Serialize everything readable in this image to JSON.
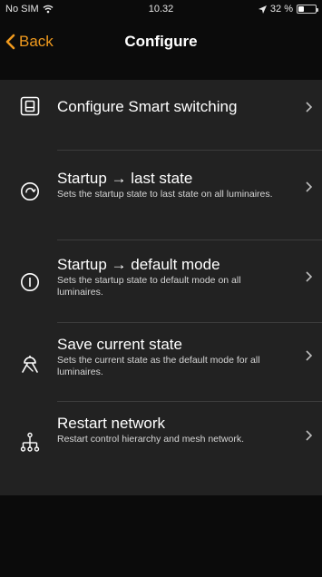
{
  "status_bar": {
    "carrier": "No SIM",
    "time": "10.32",
    "battery_text": "32 %",
    "battery_level": 0.32
  },
  "nav": {
    "back_label": "Back",
    "title": "Configure"
  },
  "colors": {
    "accent": "#f09a1e",
    "background": "#0b0b0b",
    "list_background": "#222222"
  },
  "items": [
    {
      "icon": "smart-switch-icon",
      "title": "Configure Smart switching",
      "subtitle": ""
    },
    {
      "icon": "startup-last-state-icon",
      "title": "Startup → last state",
      "subtitle": "Sets the startup state to last state on all luminaires."
    },
    {
      "icon": "startup-default-mode-icon",
      "title": "Startup → default mode",
      "subtitle": "Sets the startup state to default mode on all luminaires."
    },
    {
      "icon": "save-state-icon",
      "title": "Save current state",
      "subtitle": "Sets the current state as the default mode for all luminaires."
    },
    {
      "icon": "restart-network-icon",
      "title": "Restart network",
      "subtitle": "Restart control hierarchy and mesh network."
    }
  ]
}
